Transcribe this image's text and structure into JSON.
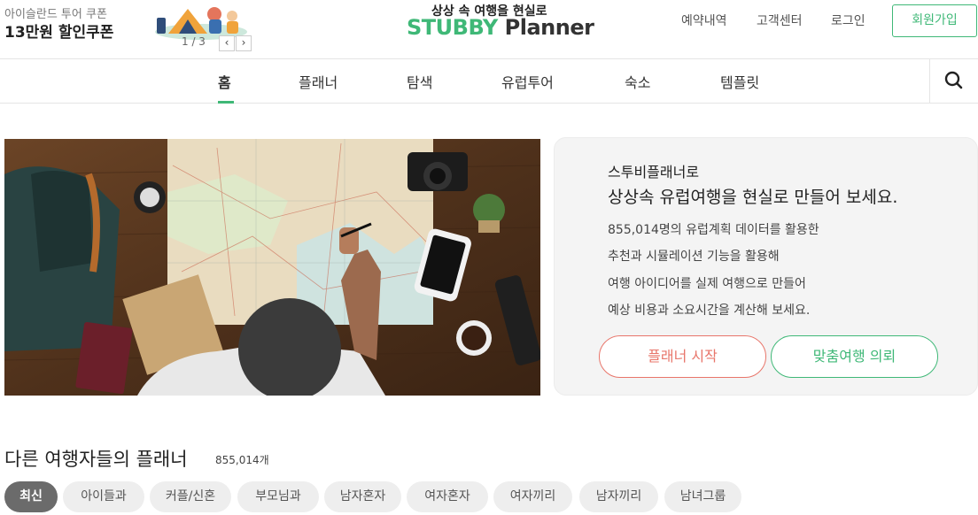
{
  "promo": {
    "subtitle": "아이슬란드 투어 쿠폰",
    "title": "13만원 할인쿠폰",
    "counter": "1 / 3",
    "prev_icon": "chevron-left-icon",
    "next_icon": "chevron-right-icon"
  },
  "logo": {
    "tagline": "상상 속 여행을 현실로",
    "word_green": "STUBBY",
    "word_dark": "Planner"
  },
  "top_links": [
    "예약내역",
    "고객센터",
    "로그인"
  ],
  "signup_label": "회원가입",
  "nav": {
    "items": [
      "홈",
      "플래너",
      "탐색",
      "유럽투어",
      "숙소",
      "템플릿"
    ],
    "active_index": 0,
    "search_icon": "search-icon"
  },
  "hero": {
    "line1": "스투비플래너로",
    "line2": "상상속 유럽여행을 현실로 만들어 보세요.",
    "bullets": [
      "855,014명의 유럽계획 데이터를 활용한",
      "추천과 시뮬레이션 기능을 활용해",
      "여행 아이디어를 실제 여행으로 만들어",
      "예상 비용과 소요시간을 계산해 보세요."
    ],
    "btn_start": "플래너 시작",
    "btn_custom": "맞춤여행 의뢰"
  },
  "section": {
    "title": "다른 여행자들의 플래너",
    "count": "855,014개",
    "chips": [
      "최신",
      "아이들과",
      "커플/신혼",
      "부모님과",
      "남자혼자",
      "여자혼자",
      "여자끼리",
      "남자끼리",
      "남녀그룹"
    ],
    "active_chip": 0
  },
  "colors": {
    "brand_green": "#3fb877",
    "accent_red": "#e8756a",
    "active_chip": "#6b6b6b",
    "chip_bg": "#eeeeee"
  }
}
